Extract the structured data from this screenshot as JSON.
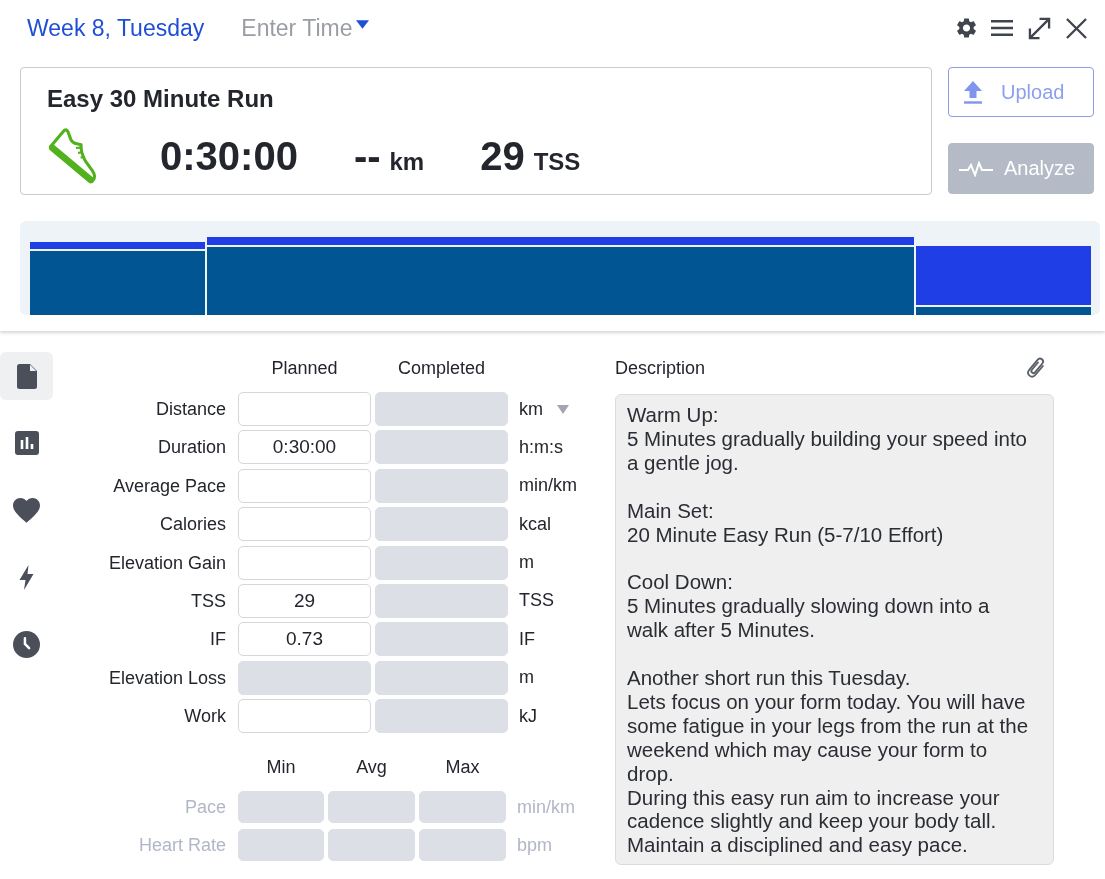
{
  "header": {
    "title": "Week 8, Tuesday",
    "time_select": {
      "placeholder": "Enter Time"
    }
  },
  "workout": {
    "title": "Easy 30 Minute Run",
    "stats": [
      {
        "value": "0:30:00"
      },
      {
        "value": "--",
        "unit": "km"
      },
      {
        "value": "29",
        "unit": "TSS"
      }
    ]
  },
  "buttons": [
    {
      "label": "Upload",
      "disabled": false
    },
    {
      "label": "Analyze",
      "disabled": true
    }
  ],
  "sidebar": {
    "tabs": [
      {
        "selected": true
      },
      {
        "selected": false
      },
      {
        "selected": false
      },
      {
        "selected": false
      },
      {
        "selected": false
      }
    ]
  },
  "form": {
    "columns": [
      "Planned",
      "Completed"
    ],
    "rows": [
      {
        "label": "Distance",
        "planned": {
          "disabled": false
        },
        "completed": {
          "disabled": true
        },
        "unit": "km",
        "unit_dropdown": true
      },
      {
        "label": "Duration",
        "planned": {
          "value": "0:30:00",
          "disabled": false
        },
        "completed": {
          "disabled": true
        },
        "unit": "h:m:s",
        "unit_dropdown": false
      },
      {
        "label": "Average Pace",
        "planned": {
          "disabled": false
        },
        "completed": {
          "disabled": true
        },
        "unit": "min/km",
        "unit_dropdown": false
      },
      {
        "label": "Calories",
        "planned": {
          "disabled": false
        },
        "completed": {
          "disabled": true
        },
        "unit": "kcal",
        "unit_dropdown": false
      },
      {
        "label": "Elevation Gain",
        "planned": {
          "disabled": false
        },
        "completed": {
          "disabled": true
        },
        "unit": "m",
        "unit_dropdown": false
      },
      {
        "label": "TSS",
        "planned": {
          "value": "29",
          "disabled": false
        },
        "completed": {
          "disabled": true
        },
        "unit": "TSS",
        "unit_dropdown": false
      },
      {
        "label": "IF",
        "planned": {
          "value": "0.73",
          "disabled": false
        },
        "completed": {
          "disabled": true
        },
        "unit": "IF",
        "unit_dropdown": false
      },
      {
        "label": "Elevation Loss",
        "planned": {
          "disabled": true
        },
        "completed": {
          "disabled": true
        },
        "unit": "m",
        "unit_dropdown": false
      },
      {
        "label": "Work",
        "planned": {
          "disabled": false
        },
        "completed": {
          "disabled": true
        },
        "unit": "kJ",
        "unit_dropdown": false
      }
    ]
  },
  "range": {
    "columns": [
      "Min",
      "Avg",
      "Max"
    ],
    "rows": [
      {
        "label": "Pace",
        "unit": "min/km",
        "disabled": true
      },
      {
        "label": "Heart Rate",
        "unit": "bpm",
        "disabled": true
      }
    ]
  },
  "description": {
    "label": "Description",
    "value": "Warm Up:\n5 Minutes gradually building your speed into a gentle jog.\n\nMain Set:\n20 Minute Easy Run (5-7/10 Effort)\n\nCool Down:\n5 Minutes gradually slowing down into a walk after 5 Minutes.\n\nAnother short run this Tuesday.\nLets focus on your form today. You will have some fatigue in your legs from the run at the weekend which may cause your form to drop.\nDuring this easy run aim to increase your cadence slightly and keep your body tall. Maintain a disciplined and easy pace."
  }
}
